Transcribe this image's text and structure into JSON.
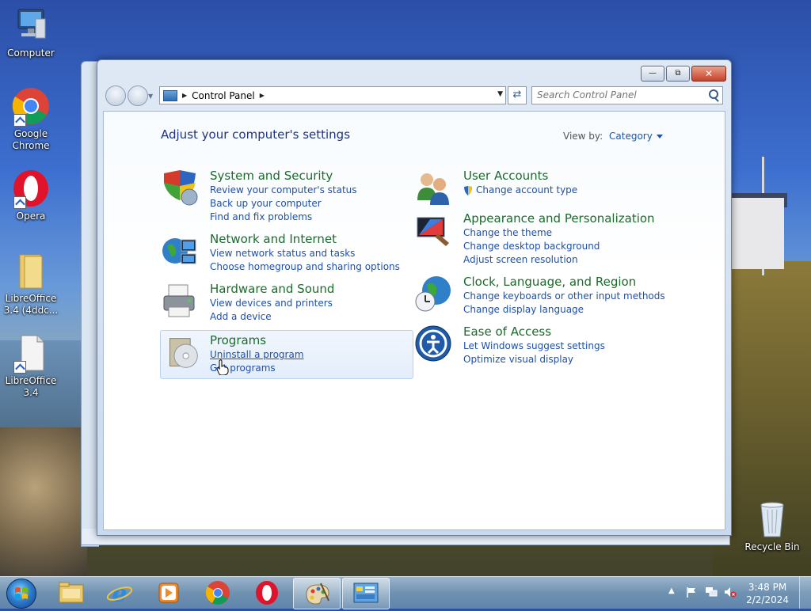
{
  "desktop": {
    "icons": [
      {
        "label": "Computer"
      },
      {
        "label": "Google\nChrome"
      },
      {
        "label": "Opera"
      },
      {
        "label": "LibreOffice\n3.4 (4ddc..."
      },
      {
        "label": "LibreOffice\n3.4"
      },
      {
        "label": "Recycle Bin"
      }
    ]
  },
  "window": {
    "address": {
      "crumb": "Control Panel"
    },
    "search": {
      "placeholder": "Search Control Panel"
    },
    "page_title": "Adjust your computer's settings",
    "view_by_label": "View by:",
    "view_by_value": "Category",
    "categories": [
      {
        "title": "System and Security",
        "links": [
          "Review your computer's status",
          "Back up your computer",
          "Find and fix problems"
        ]
      },
      {
        "title": "Network and Internet",
        "links": [
          "View network status and tasks",
          "Choose homegroup and sharing options"
        ]
      },
      {
        "title": "Hardware and Sound",
        "links": [
          "View devices and printers",
          "Add a device"
        ]
      },
      {
        "title": "Programs",
        "links": [
          "Uninstall a program",
          "Get programs"
        ]
      },
      {
        "title": "User Accounts",
        "links": [
          "Change account type"
        ]
      },
      {
        "title": "Appearance and Personalization",
        "links": [
          "Change the theme",
          "Change desktop background",
          "Adjust screen resolution"
        ]
      },
      {
        "title": "Clock, Language, and Region",
        "links": [
          "Change keyboards or other input methods",
          "Change display language"
        ]
      },
      {
        "title": "Ease of Access",
        "links": [
          "Let Windows suggest settings",
          "Optimize visual display"
        ]
      }
    ]
  },
  "taskbar": {
    "time": "3:48 PM",
    "date": "2/2/2024",
    "pinned": [
      "File Explorer",
      "Internet Explorer",
      "Windows Media Player",
      "Google Chrome",
      "Opera",
      "Paint",
      "Control Panel"
    ]
  },
  "colors": {
    "link": "#1f4fa8",
    "category_title": "#1c6a2c",
    "page_title": "#1e3287"
  }
}
